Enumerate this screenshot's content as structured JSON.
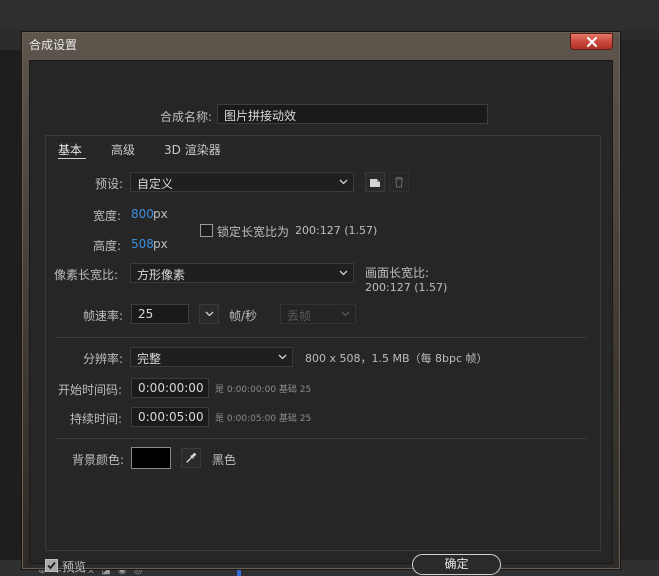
{
  "dialog": {
    "title": "合成设置",
    "name_label": "合成名称:",
    "name_value": "图片拼接动效"
  },
  "tabs": [
    {
      "label": "基本",
      "active": true
    },
    {
      "label": "高级",
      "active": false
    },
    {
      "label": "3D 渲染器",
      "active": false
    }
  ],
  "preset": {
    "label": "预设:",
    "value": "自定义"
  },
  "width": {
    "label": "宽度:",
    "value": "800",
    "unit": "px"
  },
  "height": {
    "label": "高度:",
    "value": "508",
    "unit": "px"
  },
  "lock_aspect": {
    "label": "锁定长宽比为",
    "ratio": "200:127 (1.57)",
    "checked": false
  },
  "pixel_aspect": {
    "label": "像素长宽比:",
    "value": "方形像素"
  },
  "frame_aspect": {
    "label": "画面长宽比:",
    "value": "200:127 (1.57)"
  },
  "frame_rate": {
    "label": "帧速率:",
    "value": "25",
    "unit": "帧/秒",
    "drop_frame": "丢帧"
  },
  "resolution": {
    "label": "分辨率:",
    "value": "完整",
    "info": "800 x 508，1.5 MB（每 8bpc 帧）"
  },
  "start_timecode": {
    "label": "开始时间码:",
    "value": "0:00:00:00",
    "note": "是 0:00:00:00  基础 25"
  },
  "duration": {
    "label": "持续时间:",
    "value": "0:00:05:00",
    "note": "是 0:00:05:00  基础 25"
  },
  "background": {
    "label": "背景颜色:",
    "color_name": "黑色",
    "color": "#000000"
  },
  "preview": {
    "label": "预览",
    "checked": true
  },
  "ok_label": "确定",
  "colors": {
    "accent_blue": "#3d8fe0",
    "close_red": "#c8463a"
  },
  "icons": [
    "close-icon",
    "chevron-down-icon",
    "new-preset-icon",
    "trash-icon",
    "eyedropper-icon"
  ]
}
